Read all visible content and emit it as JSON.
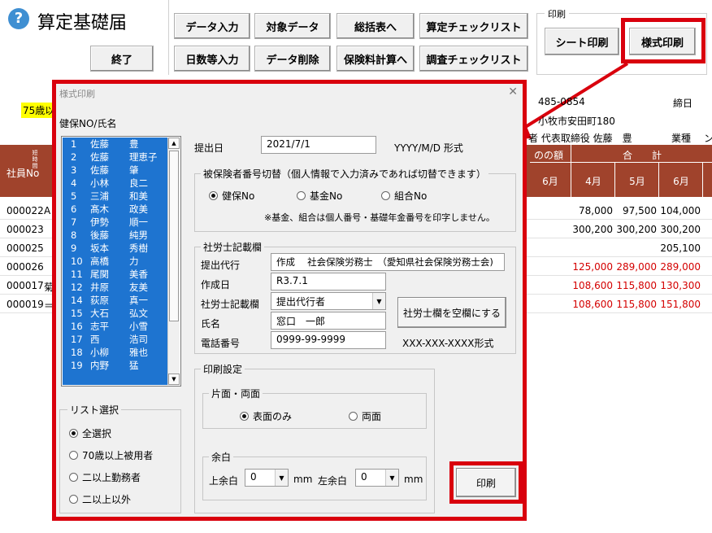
{
  "app": {
    "title": "算定基礎届",
    "exit_label": "終了"
  },
  "toolbar": {
    "data_input": "データ入力",
    "target_data": "対象データ",
    "summary": "総括表へ",
    "calc_checklist": "算定チェックリスト",
    "days_input": "日数等入力",
    "data_delete": "データ削除",
    "premium_calc": "保険料計算へ",
    "survey_checklist": "調査チェックリスト"
  },
  "print_group": {
    "label": "印刷",
    "sheet_print": "シート印刷",
    "form_print": "様式印刷"
  },
  "sheet": {
    "tag_75": "75歳以",
    "postal": "485-0854",
    "closing": "締日",
    "address": "小牧市安田町180",
    "rep": "者 代表取締役 佐藤　豊",
    "industry": "業種",
    "industry_tail": "ン",
    "col_emp_no": "社員No",
    "col_small": "短時間",
    "col_amount": "のの額",
    "col_total": "合　　計",
    "col_m6a": "6月",
    "col_m4": "4月",
    "col_m5": "5月",
    "col_m6": "6月",
    "rows": [
      {
        "id": "000022",
        "frag": "A",
        "m4": "78,000",
        "m5": "97,500",
        "m6": "104,000",
        "red": false
      },
      {
        "id": "000023",
        "frag": "",
        "m4": "300,200",
        "m5": "300,200",
        "m6": "300,200",
        "red": false
      },
      {
        "id": "000025",
        "frag": "",
        "m4": "",
        "m5": "",
        "m6": "205,100",
        "red": false
      },
      {
        "id": "000026",
        "frag": "",
        "m4": "125,000",
        "m5": "289,000",
        "m6": "289,000",
        "red": true
      },
      {
        "id": "000017",
        "frag": "菊",
        "m4": "108,600",
        "m5": "115,800",
        "m6": "130,300",
        "red": true
      },
      {
        "id": "000019",
        "frag": "＝",
        "m4": "108,600",
        "m5": "115,800",
        "m6": "151,800",
        "red": true
      }
    ]
  },
  "dialog": {
    "title": "様式印刷",
    "list_label": "健保NO/氏名",
    "employees": [
      {
        "n": "1",
        "s": "佐藤",
        "g": "豊"
      },
      {
        "n": "2",
        "s": "佐藤",
        "g": "理恵子"
      },
      {
        "n": "3",
        "s": "佐藤",
        "g": "肇"
      },
      {
        "n": "4",
        "s": "小林",
        "g": "良二"
      },
      {
        "n": "5",
        "s": "三浦",
        "g": "和美"
      },
      {
        "n": "6",
        "s": "髙木",
        "g": "政美"
      },
      {
        "n": "7",
        "s": "伊勢",
        "g": "順一"
      },
      {
        "n": "8",
        "s": "後藤",
        "g": "純男"
      },
      {
        "n": "9",
        "s": "坂本",
        "g": "秀樹"
      },
      {
        "n": "10",
        "s": "高橋",
        "g": "力"
      },
      {
        "n": "11",
        "s": "尾関",
        "g": "美香"
      },
      {
        "n": "12",
        "s": "井原",
        "g": "友美"
      },
      {
        "n": "14",
        "s": "荻原",
        "g": "真一"
      },
      {
        "n": "15",
        "s": "大石",
        "g": "弘文"
      },
      {
        "n": "16",
        "s": "志平",
        "g": "小雪"
      },
      {
        "n": "17",
        "s": "西",
        "g": "浩司"
      },
      {
        "n": "18",
        "s": "小柳",
        "g": "雅也"
      },
      {
        "n": "19",
        "s": "内野",
        "g": "猛"
      }
    ],
    "submit_date_label": "提出日",
    "submit_date_value": "2021/7/1",
    "date_format": "YYYY/M/D 形式",
    "insured_frame": "被保険者番号切替（個人情報で入力済みであれば切替できます）",
    "radio_kenpo": "健保No",
    "radio_kikin": "基金No",
    "radio_kumiai": "組合No",
    "insured_note": "※基金、組合は個人番号・基礎年金番号を印字しません。",
    "sr_frame": "社労士記載欄",
    "agent_label": "提出代行",
    "agent_value": "作成　 社会保険労務士　（愛知県社会保険労務士会)",
    "created_label": "作成日",
    "created_value": "R3.7.1",
    "sr_field_label": "社労士記載欄",
    "sr_field_value": "提出代行者",
    "name_label": "氏名",
    "name_value": "窓口　一郎",
    "phone_label": "電話番号",
    "phone_value": "0999-99-9999",
    "phone_format": "XXX-XXX-XXXX形式",
    "clear_sr_button": "社労士欄を空欄にする",
    "print_settings_frame": "印刷設定",
    "sides_frame": "片面・両面",
    "radio_single": "表面のみ",
    "radio_double": "両面",
    "margin_frame": "余白",
    "top_margin_label": "上余白",
    "top_margin_value": "0",
    "mm1": "mm",
    "left_margin_label": "左余白",
    "left_margin_value": "0",
    "mm2": "mm",
    "list_select_frame": "リスト選択",
    "sel_all": "全選択",
    "sel_70": "70歳以上被用者",
    "sel_multi": "二以上勤務者",
    "sel_other": "二以上以外",
    "print_button": "印刷"
  }
}
